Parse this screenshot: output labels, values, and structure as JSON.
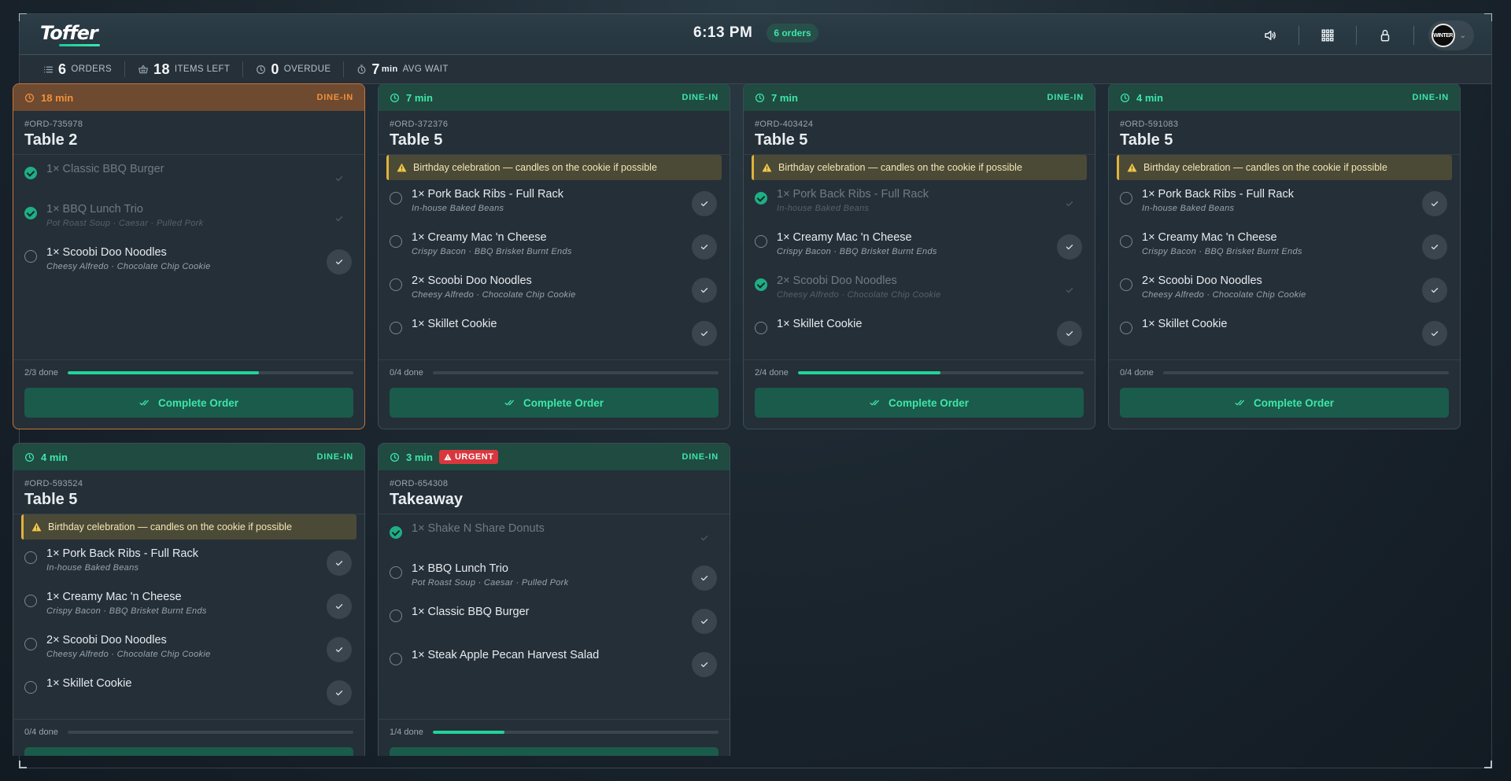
{
  "app": {
    "logo": "Toffer",
    "clock": "6:13 PM",
    "orders_pill": "6 orders",
    "avatar_text": "WINTER"
  },
  "stats": [
    {
      "icon": "list-icon",
      "num": "6",
      "unit": "",
      "label": "ORDERS"
    },
    {
      "icon": "basket-icon",
      "num": "18",
      "unit": "",
      "label": "ITEMS LEFT"
    },
    {
      "icon": "clock-icon",
      "num": "0",
      "unit": "",
      "label": "OVERDUE"
    },
    {
      "icon": "timer-icon",
      "num": "7",
      "unit": "min",
      "label": "AVG WAIT"
    }
  ],
  "complete_label": "Complete Order",
  "orders": [
    {
      "time": "18 min",
      "type": "DINE-IN",
      "id": "#ORD-735978",
      "table": "Table 2",
      "overdue": true,
      "urgent": "",
      "note": "",
      "progress_label": "2/3 done",
      "progress": 0.67,
      "items": [
        {
          "name": "1× Classic BBQ Burger",
          "mods": "",
          "done": true
        },
        {
          "name": "1× BBQ Lunch Trio",
          "mods": "Pot Roast Soup · Caesar · Pulled Pork",
          "done": true
        },
        {
          "name": "1× Scoobi Doo Noodles",
          "mods": "Cheesy Alfredo · Chocolate Chip Cookie",
          "done": false
        }
      ]
    },
    {
      "time": "7 min",
      "type": "DINE-IN",
      "id": "#ORD-372376",
      "table": "Table 5",
      "overdue": false,
      "urgent": "",
      "note": "Birthday celebration — candles on the cookie if possible",
      "progress_label": "0/4 done",
      "progress": 0,
      "items": [
        {
          "name": "1× Pork Back Ribs - Full Rack",
          "mods": "In-house Baked Beans",
          "done": false
        },
        {
          "name": "1× Creamy Mac 'n Cheese",
          "mods": "Crispy Bacon · BBQ Brisket Burnt Ends",
          "done": false
        },
        {
          "name": "2× Scoobi Doo Noodles",
          "mods": "Cheesy Alfredo · Chocolate Chip Cookie",
          "done": false
        },
        {
          "name": "1× Skillet Cookie",
          "mods": "",
          "done": false
        }
      ]
    },
    {
      "time": "7 min",
      "type": "DINE-IN",
      "id": "#ORD-403424",
      "table": "Table 5",
      "overdue": false,
      "urgent": "",
      "note": "Birthday celebration — candles on the cookie if possible",
      "progress_label": "2/4 done",
      "progress": 0.5,
      "items": [
        {
          "name": "1× Pork Back Ribs - Full Rack",
          "mods": "In-house Baked Beans",
          "done": true
        },
        {
          "name": "1× Creamy Mac 'n Cheese",
          "mods": "Crispy Bacon · BBQ Brisket Burnt Ends",
          "done": false
        },
        {
          "name": "2× Scoobi Doo Noodles",
          "mods": "Cheesy Alfredo · Chocolate Chip Cookie",
          "done": true
        },
        {
          "name": "1× Skillet Cookie",
          "mods": "",
          "done": false
        }
      ]
    },
    {
      "time": "4 min",
      "type": "DINE-IN",
      "id": "#ORD-591083",
      "table": "Table 5",
      "overdue": false,
      "urgent": "",
      "note": "Birthday celebration — candles on the cookie if possible",
      "progress_label": "0/4 done",
      "progress": 0,
      "items": [
        {
          "name": "1× Pork Back Ribs - Full Rack",
          "mods": "In-house Baked Beans",
          "done": false
        },
        {
          "name": "1× Creamy Mac 'n Cheese",
          "mods": "Crispy Bacon · BBQ Brisket Burnt Ends",
          "done": false
        },
        {
          "name": "2× Scoobi Doo Noodles",
          "mods": "Cheesy Alfredo · Chocolate Chip Cookie",
          "done": false
        },
        {
          "name": "1× Skillet Cookie",
          "mods": "",
          "done": false
        }
      ]
    },
    {
      "time": "4 min",
      "type": "DINE-IN",
      "id": "#ORD-593524",
      "table": "Table 5",
      "overdue": false,
      "urgent": "",
      "note": "Birthday celebration — candles on the cookie if possible",
      "progress_label": "0/4 done",
      "progress": 0,
      "items": [
        {
          "name": "1× Pork Back Ribs - Full Rack",
          "mods": "In-house Baked Beans",
          "done": false
        },
        {
          "name": "1× Creamy Mac 'n Cheese",
          "mods": "Crispy Bacon · BBQ Brisket Burnt Ends",
          "done": false
        },
        {
          "name": "2× Scoobi Doo Noodles",
          "mods": "Cheesy Alfredo · Chocolate Chip Cookie",
          "done": false
        },
        {
          "name": "1× Skillet Cookie",
          "mods": "",
          "done": false
        }
      ]
    },
    {
      "time": "3 min",
      "type": "DINE-IN",
      "id": "#ORD-654308",
      "table": "Takeaway",
      "overdue": false,
      "urgent": "URGENT",
      "note": "",
      "progress_label": "1/4 done",
      "progress": 0.25,
      "items": [
        {
          "name": "1× Shake N Share Donuts",
          "mods": "",
          "done": true
        },
        {
          "name": "1× BBQ Lunch Trio",
          "mods": "Pot Roast Soup · Caesar · Pulled Pork",
          "done": false
        },
        {
          "name": "1× Classic BBQ Burger",
          "mods": "",
          "done": false
        },
        {
          "name": "1× Steak Apple Pecan Harvest Salad",
          "mods": "",
          "done": false
        }
      ]
    }
  ]
}
